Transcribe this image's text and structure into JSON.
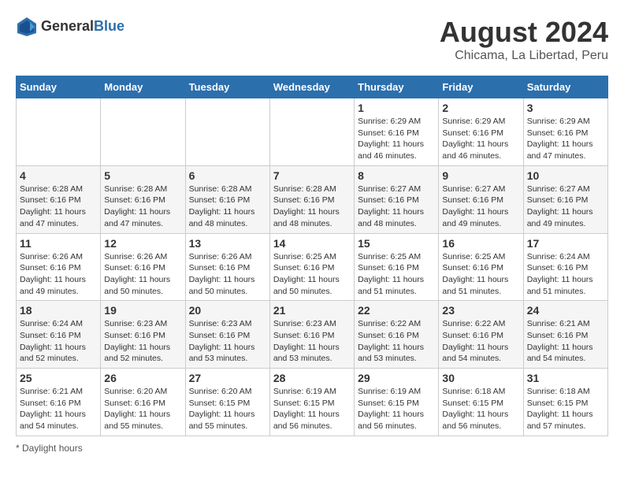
{
  "logo": {
    "general": "General",
    "blue": "Blue"
  },
  "title": "August 2024",
  "location": "Chicama, La Libertad, Peru",
  "days_header": [
    "Sunday",
    "Monday",
    "Tuesday",
    "Wednesday",
    "Thursday",
    "Friday",
    "Saturday"
  ],
  "footnote": "Daylight hours",
  "weeks": [
    [
      {
        "num": "",
        "info": ""
      },
      {
        "num": "",
        "info": ""
      },
      {
        "num": "",
        "info": ""
      },
      {
        "num": "",
        "info": ""
      },
      {
        "num": "1",
        "info": "Sunrise: 6:29 AM\nSunset: 6:16 PM\nDaylight: 11 hours and 46 minutes."
      },
      {
        "num": "2",
        "info": "Sunrise: 6:29 AM\nSunset: 6:16 PM\nDaylight: 11 hours and 46 minutes."
      },
      {
        "num": "3",
        "info": "Sunrise: 6:29 AM\nSunset: 6:16 PM\nDaylight: 11 hours and 47 minutes."
      }
    ],
    [
      {
        "num": "4",
        "info": "Sunrise: 6:28 AM\nSunset: 6:16 PM\nDaylight: 11 hours and 47 minutes."
      },
      {
        "num": "5",
        "info": "Sunrise: 6:28 AM\nSunset: 6:16 PM\nDaylight: 11 hours and 47 minutes."
      },
      {
        "num": "6",
        "info": "Sunrise: 6:28 AM\nSunset: 6:16 PM\nDaylight: 11 hours and 48 minutes."
      },
      {
        "num": "7",
        "info": "Sunrise: 6:28 AM\nSunset: 6:16 PM\nDaylight: 11 hours and 48 minutes."
      },
      {
        "num": "8",
        "info": "Sunrise: 6:27 AM\nSunset: 6:16 PM\nDaylight: 11 hours and 48 minutes."
      },
      {
        "num": "9",
        "info": "Sunrise: 6:27 AM\nSunset: 6:16 PM\nDaylight: 11 hours and 49 minutes."
      },
      {
        "num": "10",
        "info": "Sunrise: 6:27 AM\nSunset: 6:16 PM\nDaylight: 11 hours and 49 minutes."
      }
    ],
    [
      {
        "num": "11",
        "info": "Sunrise: 6:26 AM\nSunset: 6:16 PM\nDaylight: 11 hours and 49 minutes."
      },
      {
        "num": "12",
        "info": "Sunrise: 6:26 AM\nSunset: 6:16 PM\nDaylight: 11 hours and 50 minutes."
      },
      {
        "num": "13",
        "info": "Sunrise: 6:26 AM\nSunset: 6:16 PM\nDaylight: 11 hours and 50 minutes."
      },
      {
        "num": "14",
        "info": "Sunrise: 6:25 AM\nSunset: 6:16 PM\nDaylight: 11 hours and 50 minutes."
      },
      {
        "num": "15",
        "info": "Sunrise: 6:25 AM\nSunset: 6:16 PM\nDaylight: 11 hours and 51 minutes."
      },
      {
        "num": "16",
        "info": "Sunrise: 6:25 AM\nSunset: 6:16 PM\nDaylight: 11 hours and 51 minutes."
      },
      {
        "num": "17",
        "info": "Sunrise: 6:24 AM\nSunset: 6:16 PM\nDaylight: 11 hours and 51 minutes."
      }
    ],
    [
      {
        "num": "18",
        "info": "Sunrise: 6:24 AM\nSunset: 6:16 PM\nDaylight: 11 hours and 52 minutes."
      },
      {
        "num": "19",
        "info": "Sunrise: 6:23 AM\nSunset: 6:16 PM\nDaylight: 11 hours and 52 minutes."
      },
      {
        "num": "20",
        "info": "Sunrise: 6:23 AM\nSunset: 6:16 PM\nDaylight: 11 hours and 53 minutes."
      },
      {
        "num": "21",
        "info": "Sunrise: 6:23 AM\nSunset: 6:16 PM\nDaylight: 11 hours and 53 minutes."
      },
      {
        "num": "22",
        "info": "Sunrise: 6:22 AM\nSunset: 6:16 PM\nDaylight: 11 hours and 53 minutes."
      },
      {
        "num": "23",
        "info": "Sunrise: 6:22 AM\nSunset: 6:16 PM\nDaylight: 11 hours and 54 minutes."
      },
      {
        "num": "24",
        "info": "Sunrise: 6:21 AM\nSunset: 6:16 PM\nDaylight: 11 hours and 54 minutes."
      }
    ],
    [
      {
        "num": "25",
        "info": "Sunrise: 6:21 AM\nSunset: 6:16 PM\nDaylight: 11 hours and 54 minutes."
      },
      {
        "num": "26",
        "info": "Sunrise: 6:20 AM\nSunset: 6:16 PM\nDaylight: 11 hours and 55 minutes."
      },
      {
        "num": "27",
        "info": "Sunrise: 6:20 AM\nSunset: 6:15 PM\nDaylight: 11 hours and 55 minutes."
      },
      {
        "num": "28",
        "info": "Sunrise: 6:19 AM\nSunset: 6:15 PM\nDaylight: 11 hours and 56 minutes."
      },
      {
        "num": "29",
        "info": "Sunrise: 6:19 AM\nSunset: 6:15 PM\nDaylight: 11 hours and 56 minutes."
      },
      {
        "num": "30",
        "info": "Sunrise: 6:18 AM\nSunset: 6:15 PM\nDaylight: 11 hours and 56 minutes."
      },
      {
        "num": "31",
        "info": "Sunrise: 6:18 AM\nSunset: 6:15 PM\nDaylight: 11 hours and 57 minutes."
      }
    ]
  ]
}
